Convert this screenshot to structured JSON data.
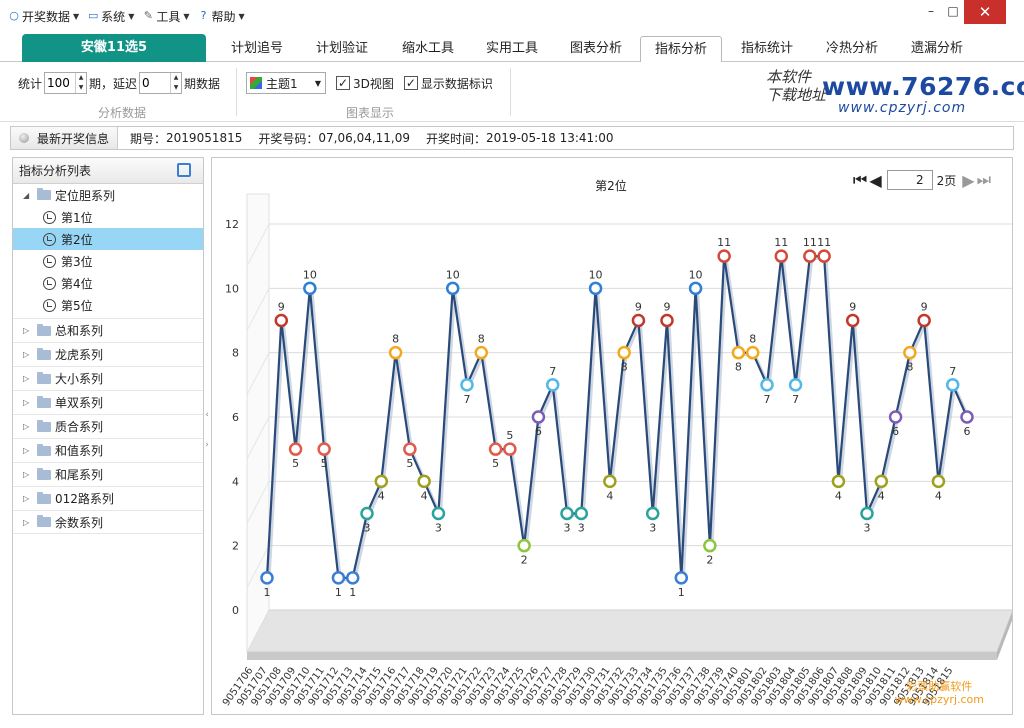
{
  "menu": {
    "items": [
      {
        "label": "开奖数据",
        "icon": "circle-icon"
      },
      {
        "label": "系统",
        "icon": "monitor-icon"
      },
      {
        "label": "工具",
        "icon": "tools-icon"
      },
      {
        "label": "帮助",
        "icon": "help-icon"
      }
    ]
  },
  "window": {
    "minimize": "–",
    "maximize": "□",
    "close": "✕"
  },
  "tabs": [
    {
      "label": "安徽11选5",
      "state": "brand"
    },
    {
      "label": "计划追号"
    },
    {
      "label": "计划验证"
    },
    {
      "label": "缩水工具"
    },
    {
      "label": "实用工具"
    },
    {
      "label": "图表分析"
    },
    {
      "label": "指标分析",
      "state": "active"
    },
    {
      "label": "指标统计"
    },
    {
      "label": "冷热分析"
    },
    {
      "label": "遗漏分析"
    }
  ],
  "toolbar": {
    "stat_label": "统计",
    "stat_value": "100",
    "period_label": "期，延迟",
    "delay_value": "0",
    "data_label": "期数据",
    "group1_caption": "分析数据",
    "theme_value": "主题1",
    "check_3d": "3D视图",
    "check_3d_checked": true,
    "check_labels": "显示数据标识",
    "check_labels_checked": true,
    "group2_caption": "图表显示"
  },
  "logo": {
    "cn": "本软件 下载地址",
    "url_main": "www.76276.com",
    "url_sub": "www.cpzyrj.com"
  },
  "info": {
    "button": "最新开奖信息",
    "period_label": "期号：",
    "period": "2019051815",
    "numbers_label": "开奖号码：",
    "numbers": "07,06,04,11,09",
    "time_label": "开奖时间：",
    "time": "2019-05-18 13:41:00"
  },
  "sidebar": {
    "title": "指标分析列表",
    "groups": [
      {
        "label": "定位胆系列",
        "expanded": true,
        "children": [
          "第1位",
          "第2位",
          "第3位",
          "第4位",
          "第5位"
        ],
        "selected": 1
      },
      {
        "label": "总和系列"
      },
      {
        "label": "龙虎系列"
      },
      {
        "label": "大小系列"
      },
      {
        "label": "单双系列"
      },
      {
        "label": "质合系列"
      },
      {
        "label": "和值系列"
      },
      {
        "label": "和尾系列"
      },
      {
        "label": "012路系列"
      },
      {
        "label": "余数系列"
      }
    ]
  },
  "pager": {
    "current": "2",
    "total_label": "2页"
  },
  "watermark": {
    "line1": "彩票助赢软件",
    "line2": "www.cpzyrj.com"
  },
  "chart_data": {
    "type": "line",
    "title": "第2位",
    "ylim": [
      0,
      12
    ],
    "yticks": [
      0,
      2,
      4,
      6,
      8,
      10,
      12
    ],
    "view_3d": true,
    "grid": true,
    "series_color": "#2a4a7a",
    "x": [
      "9051706",
      "9051707",
      "9051708",
      "9051709",
      "9051710",
      "9051711",
      "9051712",
      "9051713",
      "9051714",
      "9051715",
      "9051716",
      "9051717",
      "9051718",
      "9051719",
      "9051720",
      "9051721",
      "9051722",
      "9051723",
      "9051724",
      "9051725",
      "9051726",
      "9051727",
      "9051728",
      "9051729",
      "9051730",
      "9051731",
      "9051732",
      "9051733",
      "9051734",
      "9051735",
      "9051736",
      "9051737",
      "9051738",
      "9051739",
      "9051740",
      "9051801",
      "9051802",
      "9051803",
      "9051804",
      "9051805",
      "9051806",
      "9051807",
      "9051808",
      "9051809",
      "9051810",
      "9051811",
      "9051812",
      "9051813",
      "9051814",
      "9051815"
    ],
    "values": [
      1,
      9,
      5,
      10,
      5,
      1,
      1,
      3,
      4,
      8,
      5,
      4,
      3,
      10,
      7,
      8,
      5,
      5,
      2,
      6,
      7,
      3,
      3,
      10,
      4,
      8,
      9,
      3,
      9,
      1,
      10,
      2,
      11,
      8,
      8,
      7,
      11,
      7,
      11,
      11,
      4,
      9,
      3,
      4,
      6,
      8,
      9,
      4,
      7,
      6
    ],
    "point_colors": {
      "1": "#3a7fd5",
      "2": "#8cc63f",
      "3": "#2aa39a",
      "4": "#a0a01c",
      "5": "#e05b4b",
      "6": "#7c5cb8",
      "7": "#52b8e8",
      "8": "#f3a81e",
      "9": "#c0392b",
      "10": "#2e7fd5",
      "11": "#d34a3c"
    }
  }
}
